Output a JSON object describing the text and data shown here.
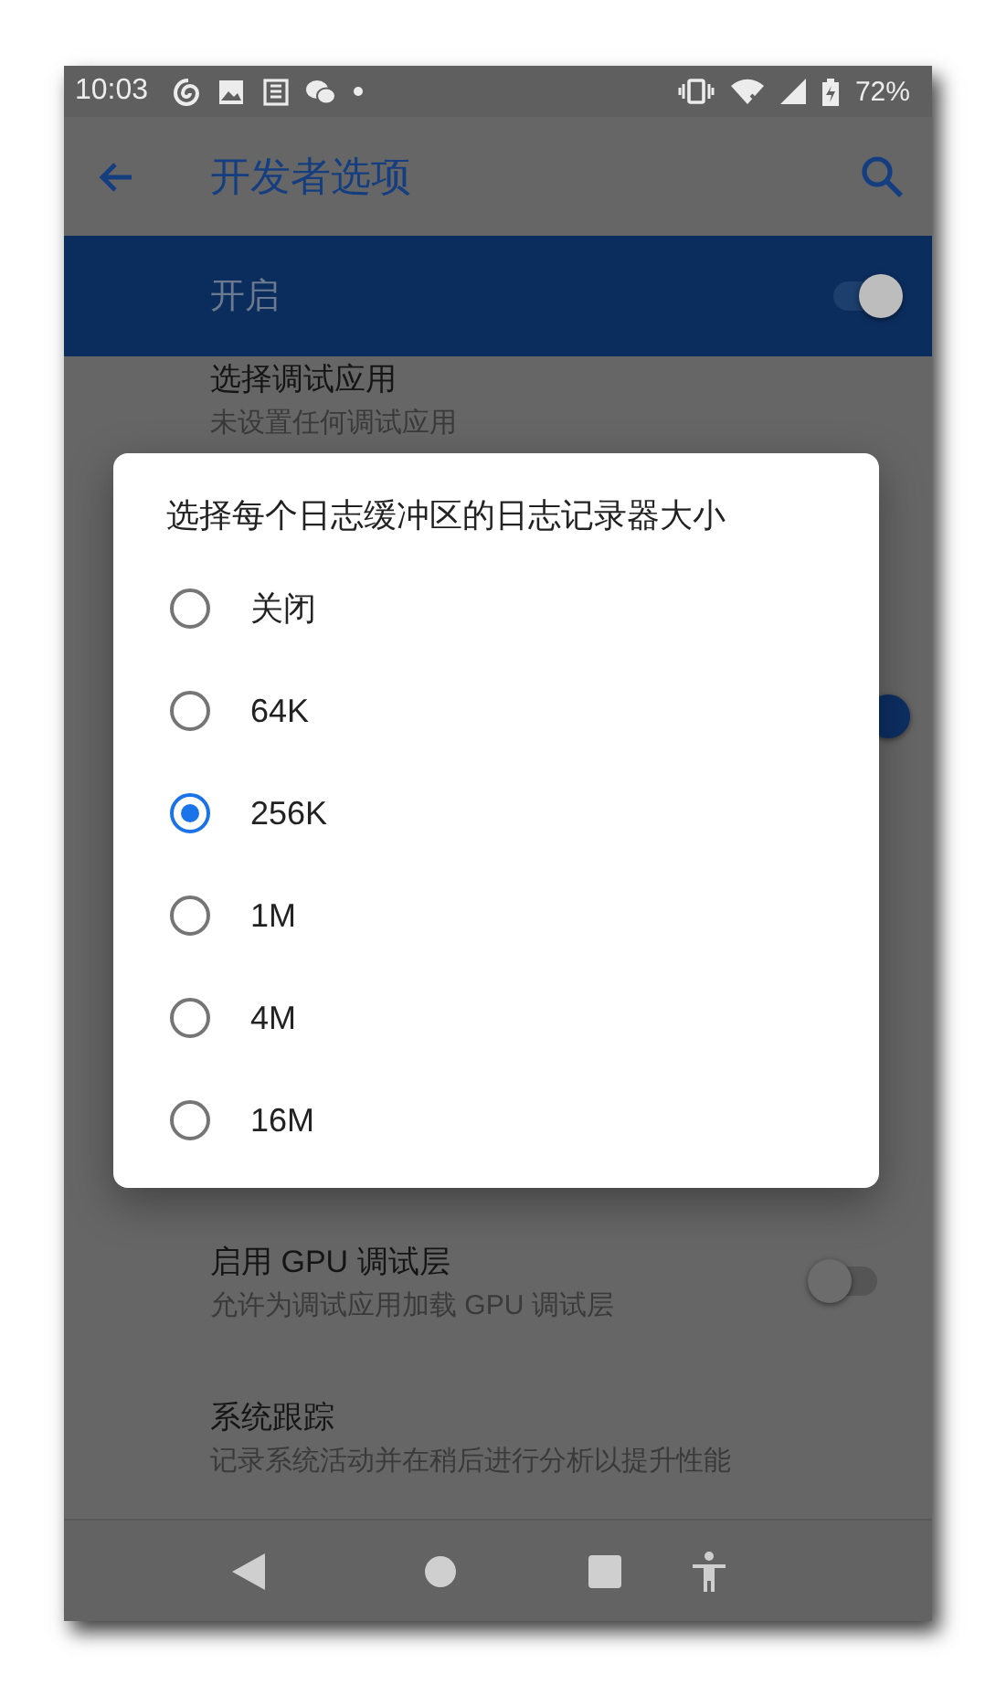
{
  "status_bar": {
    "time": "10:03",
    "battery": "72%"
  },
  "app_bar": {
    "title": "开发者选项"
  },
  "master_switch": {
    "label": "开启",
    "on": true
  },
  "settings": [
    {
      "kind": "item",
      "title": "选择调试应用",
      "subtitle": "未设置任何调试应用"
    },
    {
      "kind": "hidden-switch",
      "on": true
    },
    {
      "kind": "switch",
      "title": "启用 GPU 调试层",
      "subtitle": "允许为调试应用加载 GPU 调试层",
      "on": false
    },
    {
      "kind": "item",
      "title": "系统跟踪",
      "subtitle": "记录系统活动并在稍后进行分析以提升性能"
    }
  ],
  "dialog": {
    "title": "选择每个日志缓冲区的日志记录器大小",
    "options": [
      {
        "label": "关闭",
        "selected": false
      },
      {
        "label": "64K",
        "selected": false
      },
      {
        "label": "256K",
        "selected": true
      },
      {
        "label": "1M",
        "selected": false
      },
      {
        "label": "4M",
        "selected": false
      },
      {
        "label": "16M",
        "selected": false
      }
    ]
  }
}
